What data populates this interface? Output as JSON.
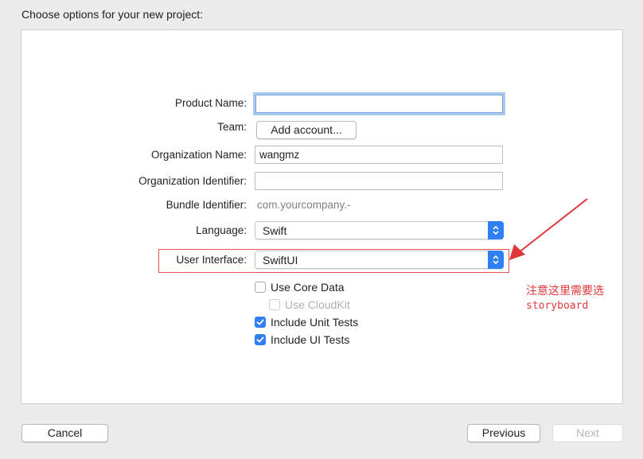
{
  "header": {
    "title": "Choose options for your new project:"
  },
  "form": {
    "product_name": {
      "label": "Product Name:",
      "value": ""
    },
    "team": {
      "label": "Team:",
      "button": "Add account..."
    },
    "organization_name": {
      "label": "Organization Name:",
      "value": "wangmz"
    },
    "organization_identifier": {
      "label": "Organization Identifier:",
      "value": ""
    },
    "bundle_identifier": {
      "label": "Bundle Identifier:",
      "value": "com.yourcompany.-"
    },
    "language": {
      "label": "Language:",
      "value": "Swift"
    },
    "user_interface": {
      "label": "User Interface:",
      "value": "SwiftUI"
    },
    "options": {
      "use_core_data": {
        "label": "Use Core Data",
        "checked": false
      },
      "use_cloudkit": {
        "label": "Use CloudKit",
        "checked": false,
        "enabled": false
      },
      "include_unit_tests": {
        "label": "Include Unit Tests",
        "checked": true
      },
      "include_ui_tests": {
        "label": "Include UI Tests",
        "checked": true
      }
    }
  },
  "annotation": {
    "note_cn": "注意这里需要选",
    "note_en": "storyboard",
    "color": "#e0383a"
  },
  "footer": {
    "cancel": "Cancel",
    "previous": "Previous",
    "next": "Next"
  },
  "colors": {
    "accent": "#2f7ff5",
    "window_bg": "#ececec"
  }
}
